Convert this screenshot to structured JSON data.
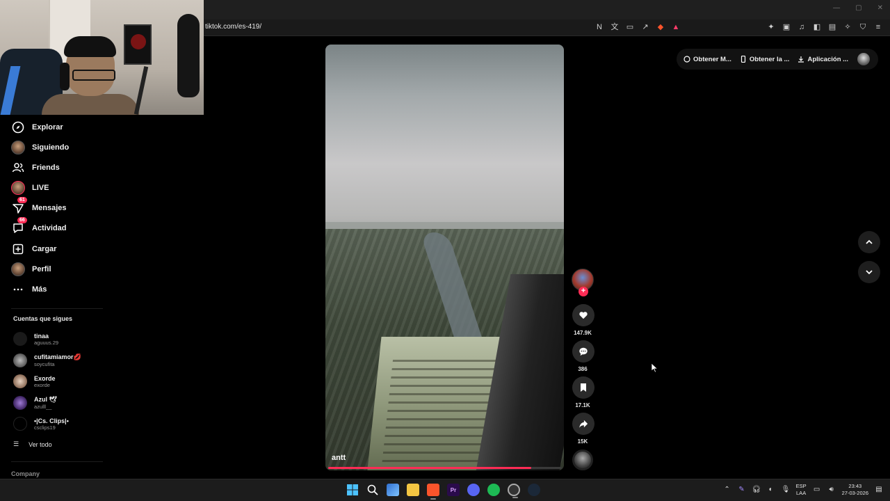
{
  "browser": {
    "url": "tiktok.com/es-419/"
  },
  "sidebar": {
    "items": [
      {
        "label": "Explorar",
        "icon": "compass-icon"
      },
      {
        "label": "Siguiendo",
        "icon": "following-avatar"
      },
      {
        "label": "Friends",
        "icon": "friends-icon"
      },
      {
        "label": "LIVE",
        "icon": "live-avatar"
      },
      {
        "label": "Mensajes",
        "icon": "messages-icon",
        "badge": "61"
      },
      {
        "label": "Actividad",
        "icon": "activity-icon",
        "badge": "66"
      },
      {
        "label": "Cargar",
        "icon": "upload-icon"
      },
      {
        "label": "Perfil",
        "icon": "profile-avatar"
      },
      {
        "label": "Más",
        "icon": "more-icon"
      }
    ],
    "following_title": "Cuentas que sigues",
    "following": [
      {
        "name": "tinaa",
        "handle": "aguuus.29"
      },
      {
        "name": "cufitamiamor💋",
        "handle": "soycufita"
      },
      {
        "name": "Exorde",
        "handle": "exorde"
      },
      {
        "name": "Azul 🕊",
        "handle": "azulll__"
      },
      {
        "name": "•|Cs. Clips|•",
        "handle": "csclips19"
      }
    ],
    "see_all": "Ver todo",
    "company": "Company"
  },
  "video": {
    "caption": "antt",
    "progress": 0.87
  },
  "actions": {
    "likes": "147.9K",
    "comments": "386",
    "saves": "17.1K",
    "shares": "15K"
  },
  "top_pills": {
    "pill1": "Obtener M...",
    "pill2": "Obtener la ...",
    "pill3": "Aplicación ..."
  },
  "taskbar": {
    "lang_top": "ESP",
    "lang_bottom": "LAA",
    "time": "23:43",
    "date": "27-03-2026"
  },
  "colors": {
    "accent": "#fe2c55",
    "background": "#000000"
  }
}
